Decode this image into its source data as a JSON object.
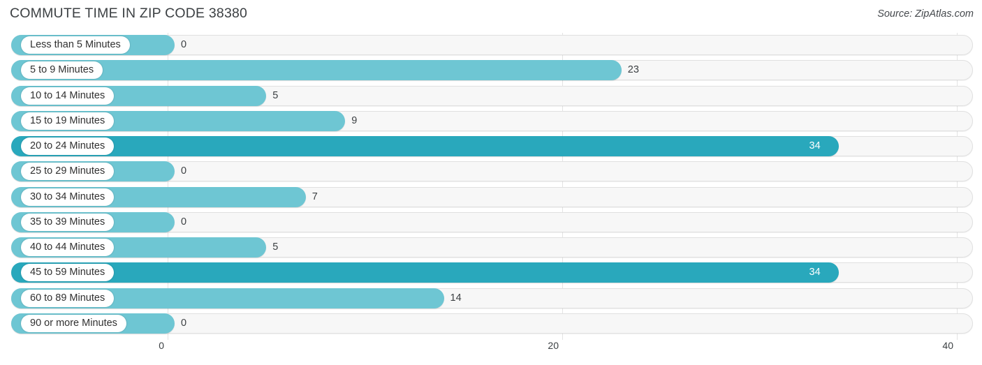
{
  "header": {
    "title": "COMMUTE TIME IN ZIP CODE 38380",
    "source": "Source: ZipAtlas.com"
  },
  "colors": {
    "bar_light": "#6ec6d3",
    "bar_dark": "#29a8bc",
    "track": "#f7f7f7",
    "track_border": "#e0e0e0",
    "gridline": "#e3e3e3",
    "text": "#3c4043",
    "value_in_bar": "#ffffff"
  },
  "chart_data": {
    "type": "bar",
    "orientation": "horizontal",
    "title": "COMMUTE TIME IN ZIP CODE 38380",
    "xlabel": "",
    "ylabel": "",
    "xlim": [
      0,
      40
    ],
    "grid": true,
    "legend": null,
    "tick_labels": [
      "0",
      "20",
      "40"
    ],
    "ticks": [
      0,
      20,
      40
    ],
    "categories": [
      "Less than 5 Minutes",
      "5 to 9 Minutes",
      "10 to 14 Minutes",
      "15 to 19 Minutes",
      "20 to 24 Minutes",
      "25 to 29 Minutes",
      "30 to 34 Minutes",
      "35 to 39 Minutes",
      "40 to 44 Minutes",
      "45 to 59 Minutes",
      "60 to 89 Minutes",
      "90 or more Minutes"
    ],
    "values": [
      0,
      23,
      5,
      9,
      34,
      0,
      7,
      0,
      5,
      34,
      14,
      0
    ],
    "value_labels": [
      "0",
      "23",
      "5",
      "9",
      "34",
      "0",
      "7",
      "0",
      "5",
      "34",
      "14",
      "0"
    ]
  }
}
